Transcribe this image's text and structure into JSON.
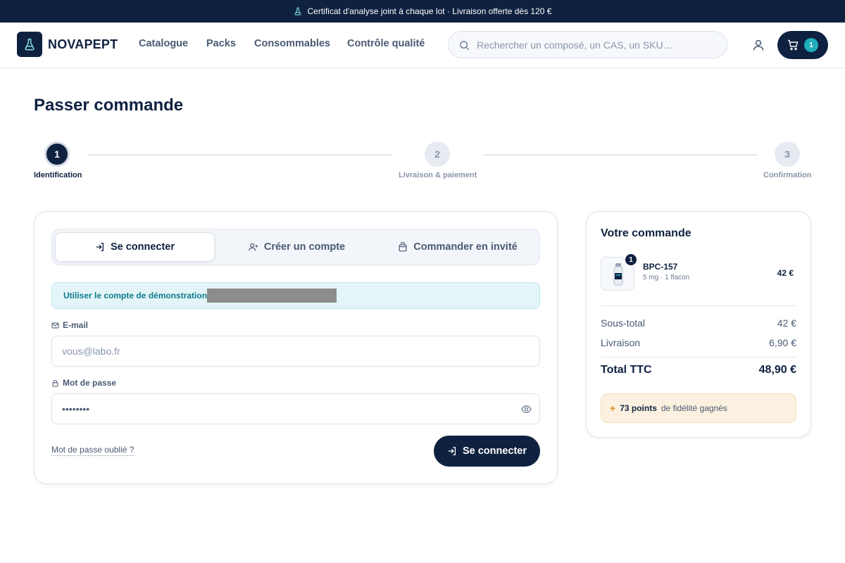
{
  "announcement": {
    "icon": "flask-icon",
    "text": "Certificat d'analyse joint à chaque lot · Livraison offerte dès 120 €"
  },
  "header": {
    "logo_icon": "flask-icon",
    "brand": "NOVAPEPT",
    "nav": [
      "Catalogue",
      "Packs",
      "Consommables",
      "Contrôle qualité"
    ],
    "search_placeholder": "Rechercher un composé, un CAS, un SKU…",
    "account_icon": "user-icon",
    "cart_icon": "cart-icon",
    "cart_count": "1"
  },
  "page": {
    "title": "Passer commande"
  },
  "steps": [
    {
      "number": "1",
      "label": "Identification",
      "state": "active"
    },
    {
      "number": "2",
      "label": "Livraison & paiement",
      "state": "todo"
    },
    {
      "number": "3",
      "label": "Confirmation",
      "state": "todo"
    }
  ],
  "auth": {
    "tabs": [
      {
        "label": "Se connecter",
        "icon": "login-icon",
        "active": true
      },
      {
        "label": "Créer un compte",
        "icon": "user-plus-icon",
        "active": false
      },
      {
        "label": "Commander en invité",
        "icon": "shopping-bag-icon",
        "active": false
      }
    ],
    "demo_text": "Utiliser le compte de démonstration",
    "email_label": "E-mail",
    "email_icon": "mail-icon",
    "email_placeholder": "vous@labo.fr",
    "password_label": "Mot de passe",
    "password_icon": "lock-icon",
    "password_value": "••••••••",
    "show_password_icon": "eye-icon",
    "forgot_link": "Mot de passe oublié ?",
    "submit_label": "Se connecter",
    "submit_icon": "login-icon"
  },
  "order": {
    "title": "Votre commande",
    "item": {
      "name": "BPC-157",
      "meta": "5 mg · 1 flacon",
      "price": "42 €",
      "quantity": "1",
      "image_icon": "vial-icon"
    },
    "subtotal_label": "Sous-total",
    "subtotal_value": "42 €",
    "shipping_label": "Livraison",
    "shipping_value": "6,90 €",
    "total_label": "Total TTC",
    "total_value": "48,90 €",
    "points_prefix": "+",
    "points_value": "73 points",
    "points_suffix": "de fidélité gagnés"
  },
  "colors": {
    "navy": "#0f2140",
    "teal": "#20aebd",
    "demo_bg": "#e3f5f8",
    "points_bg": "#fcf1e0"
  }
}
